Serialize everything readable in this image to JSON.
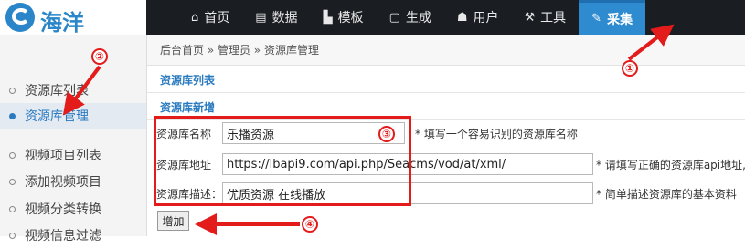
{
  "logo": {
    "name": "海洋"
  },
  "nav": [
    {
      "label": "首页",
      "icon": "home-icon",
      "glyph": "⌂"
    },
    {
      "label": "数据",
      "icon": "book-icon",
      "glyph": "▤"
    },
    {
      "label": "模板",
      "icon": "file-icon",
      "glyph": "▙"
    },
    {
      "label": "生成",
      "icon": "document-icon",
      "glyph": "▢"
    },
    {
      "label": "用户",
      "icon": "user-icon",
      "glyph": "☗"
    },
    {
      "label": "工具",
      "icon": "wrench-icon",
      "glyph": "⚒"
    },
    {
      "label": "采集",
      "icon": "edit-icon",
      "glyph": "✎",
      "active": true
    }
  ],
  "sidebar": {
    "items": [
      {
        "label": "资源库列表"
      },
      {
        "label": "资源库管理",
        "active": true
      },
      {
        "label": "视频项目列表"
      },
      {
        "label": "添加视频项目"
      },
      {
        "label": "视频分类转换"
      },
      {
        "label": "视频信息过滤"
      }
    ]
  },
  "breadcrumb": "后台首页 » 管理员 » 资源库管理",
  "list_title": "资源库列表",
  "form": {
    "title": "资源库新增",
    "name": {
      "label": "资源库名称",
      "value": "乐播资源",
      "hint": "* 填写一个容易识别的资源库名称"
    },
    "url": {
      "label": "资源库地址",
      "value": "https://lbapi9.com/api.php/Seacms/vod/at/xml/",
      "hint": "* 请填写正确的资源库api地址,..."
    },
    "desc": {
      "label": "资源库描述：",
      "value": "优质资源 在线播放",
      "hint": "* 简单描述资源库的基本资料"
    },
    "submit_label": "增加"
  },
  "annotations": [
    "①",
    "②",
    "③",
    "④"
  ],
  "colors": {
    "accent": "#2e8bd0",
    "annotation": "#e31b1b",
    "topbar": "#1a1d22"
  }
}
